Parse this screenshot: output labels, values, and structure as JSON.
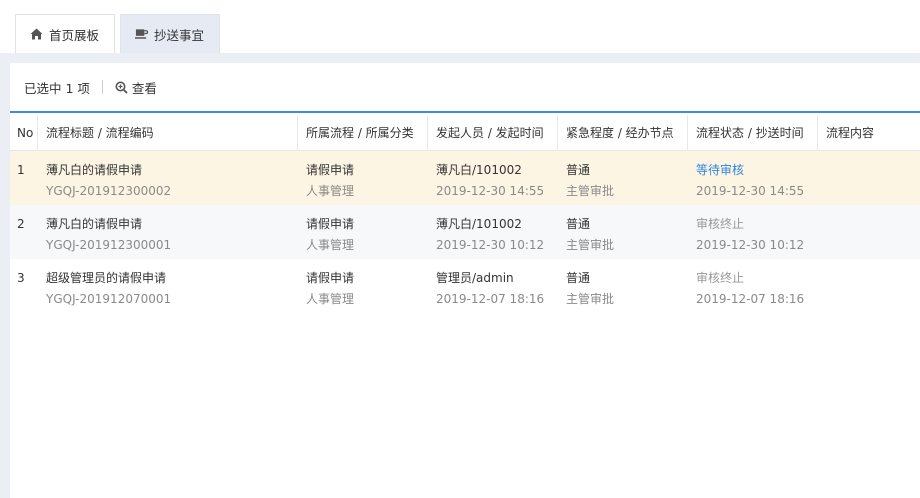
{
  "tabs": [
    {
      "label": "首页展板",
      "icon": "home-icon"
    },
    {
      "label": "抄送事宜",
      "icon": "coffee-cup-icon"
    }
  ],
  "toolbar": {
    "selected_text": "已选中 1 项",
    "view_label": "查看",
    "view_icon": "zoom-icon"
  },
  "table": {
    "headers": [
      "No",
      "流程标题 / 流程编码",
      "所属流程 / 所属分类",
      "发起人员 / 发起时间",
      "紧急程度 / 经办节点",
      "流程状态 / 抄送时间",
      "流程内容"
    ],
    "rows": [
      {
        "no": "1",
        "title": "薄凡白的请假申请",
        "code": "YGQJ-201912300002",
        "flow": "请假申请",
        "category": "人事管理",
        "initiator": "薄凡白/101002",
        "start_time": "2019-12-30 14:55",
        "urgency": "普通",
        "node": "主管审批",
        "status": "等待审核",
        "cc_time": "2019-12-30 14:55",
        "content": ""
      },
      {
        "no": "2",
        "title": "薄凡白的请假申请",
        "code": "YGQJ-201912300001",
        "flow": "请假申请",
        "category": "人事管理",
        "initiator": "薄凡白/101002",
        "start_time": "2019-12-30 10:12",
        "urgency": "普通",
        "node": "主管审批",
        "status": "审核终止",
        "cc_time": "2019-12-30 10:12",
        "content": ""
      },
      {
        "no": "3",
        "title": "超级管理员的请假申请",
        "code": "YGQJ-201912070001",
        "flow": "请假申请",
        "category": "人事管理",
        "initiator": "管理员/admin",
        "start_time": "2019-12-07 18:16",
        "urgency": "普通",
        "node": "主管审批",
        "status": "审核终止",
        "cc_time": "2019-12-07 18:16",
        "content": ""
      }
    ]
  },
  "colors": {
    "accent": "#3d8ed6",
    "selected_row": "#fdf5e4",
    "status_pending": "#2e86de"
  }
}
